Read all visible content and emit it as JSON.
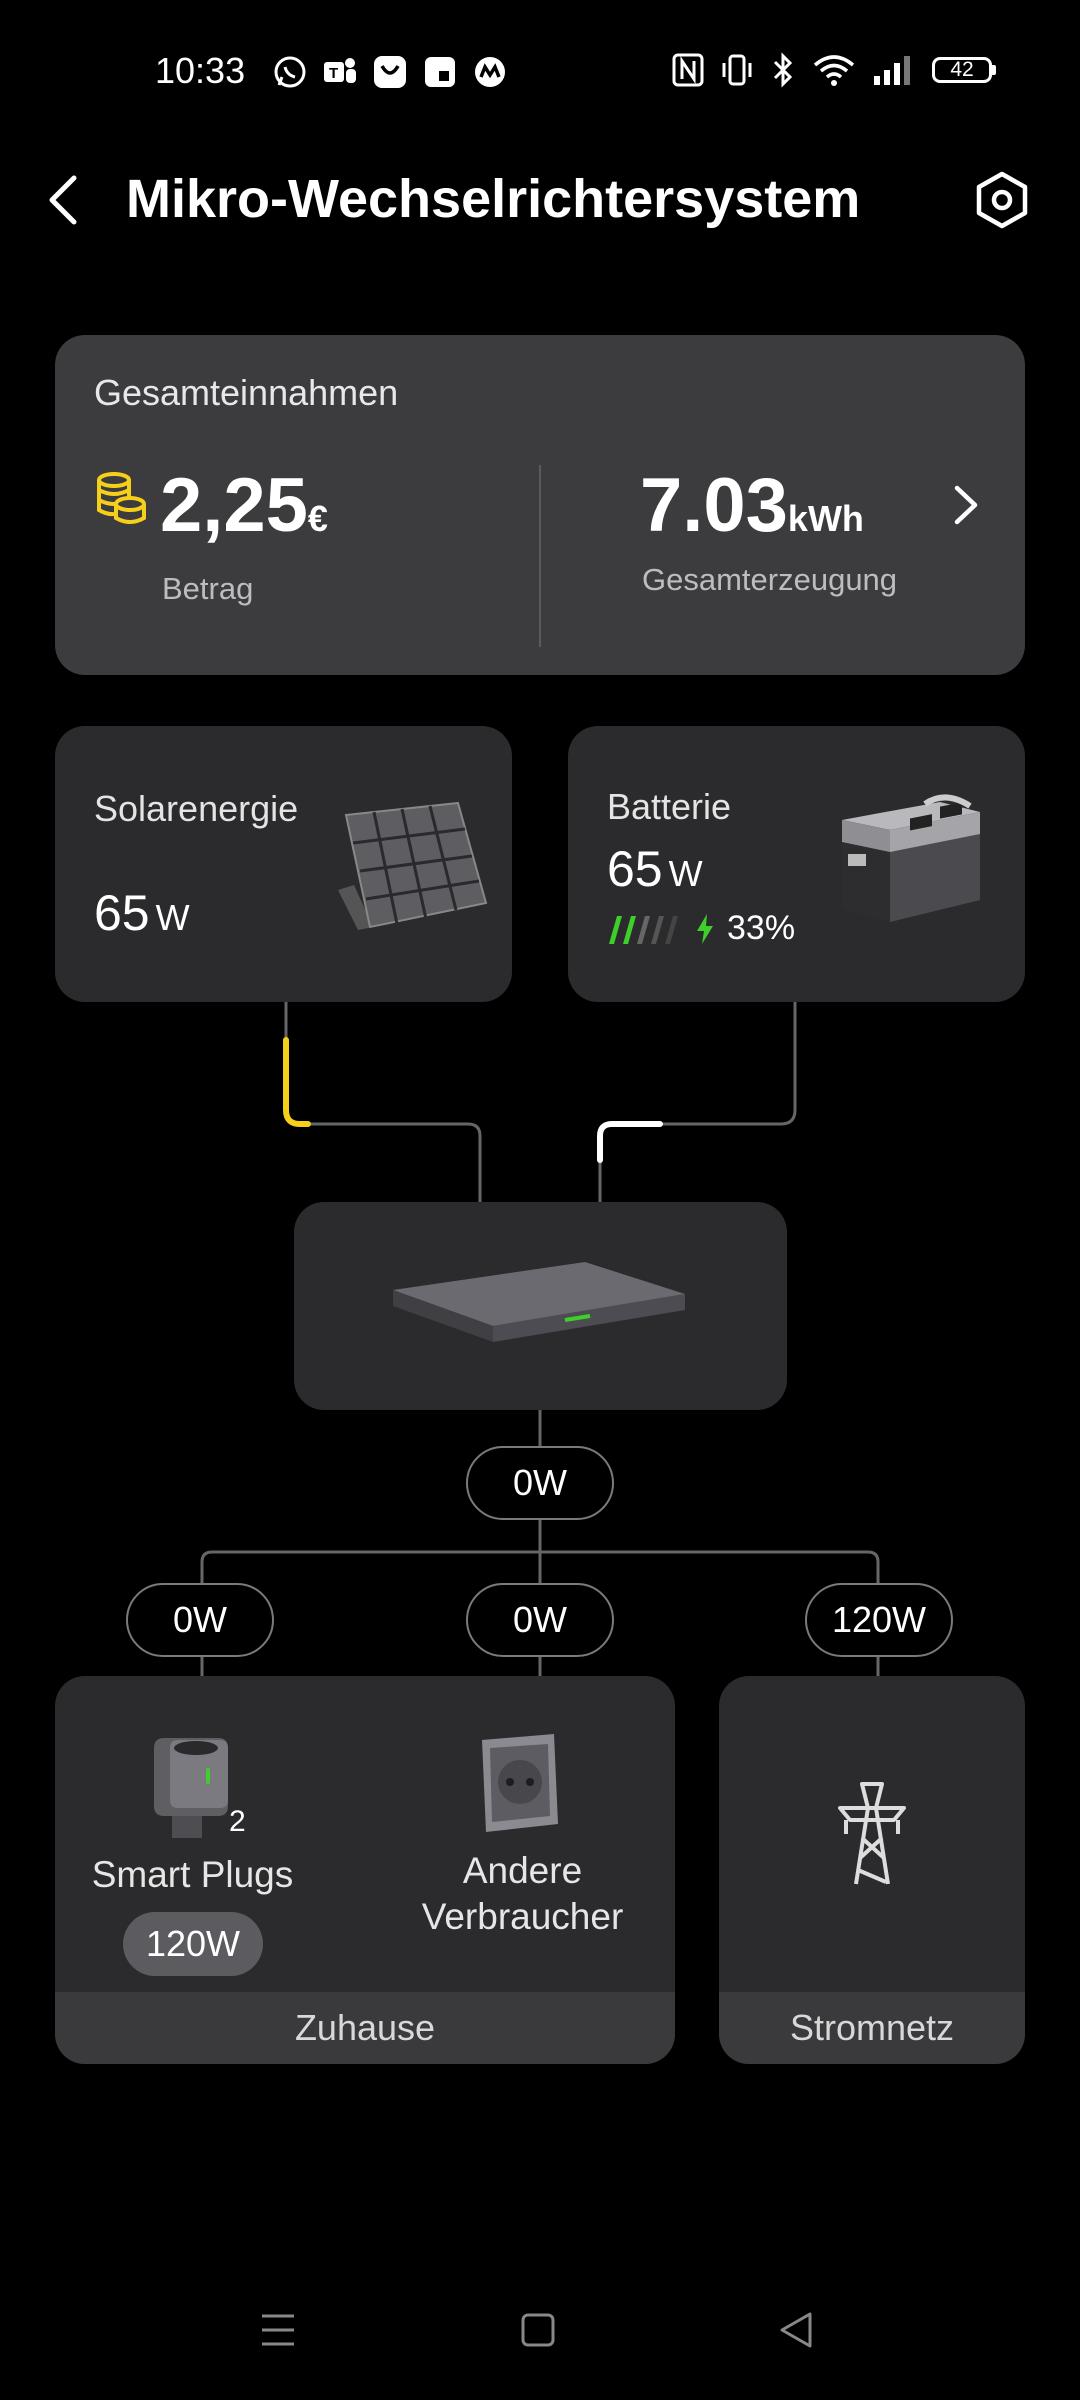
{
  "status_bar": {
    "time": "10:33",
    "battery": "42",
    "app_icons": [
      "whatsapp-icon",
      "teams-icon",
      "shop-icon",
      "notes-icon",
      "app-icon"
    ],
    "system_icons": [
      "nfc-icon",
      "vibrate-icon",
      "bluetooth-icon",
      "wifi-icon",
      "signal-icon"
    ]
  },
  "header": {
    "title": "Mikro-Wechselrichtersystem"
  },
  "earnings": {
    "title": "Gesamteinnahmen",
    "amount": "2,25",
    "amount_unit": "€",
    "amount_label": "Betrag",
    "energy": "7.03",
    "energy_unit": "kWh",
    "energy_label": "Gesamterzeugung"
  },
  "solar": {
    "label": "Solarenergie",
    "value": "65",
    "unit": "W"
  },
  "battery": {
    "label": "Batterie",
    "value": "65",
    "unit": "W",
    "percent": "33%",
    "level_fraction": 0.33
  },
  "flows": {
    "total": "0W",
    "smart_plugs": "0W",
    "other": "0W",
    "grid": "120W"
  },
  "home": {
    "smart_plugs_label": "Smart Plugs",
    "smart_plugs_count": "2",
    "smart_plugs_power": "120W",
    "other_label": "Andere Verbraucher",
    "footer": "Zuhause"
  },
  "grid": {
    "footer": "Stromnetz"
  },
  "colors": {
    "accent_yellow": "#f5cf1a",
    "accent_green": "#3ecf2a",
    "card": "#2b2b2d",
    "card_top": "#3c3c3f"
  }
}
